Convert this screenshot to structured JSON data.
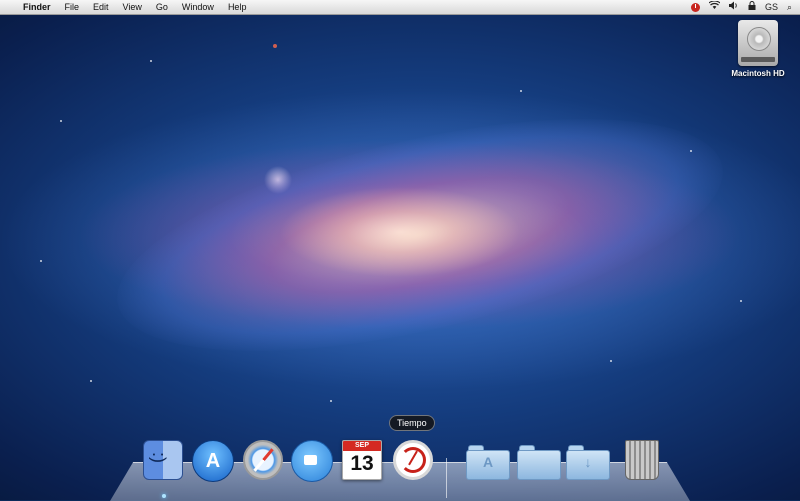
{
  "menubar": {
    "apple_glyph": "",
    "app_name": "Finder",
    "menus": [
      "File",
      "Edit",
      "View",
      "Go",
      "Window",
      "Help"
    ],
    "status_icons": {
      "time_machine": "time-machine-icon",
      "wifi": "wifi-icon",
      "volume": "volume-icon",
      "lock": "lock-icon"
    },
    "user": "GS",
    "spotlight_glyph": "⌕"
  },
  "desktop": {
    "hd_label": "Macintosh HD"
  },
  "dock": {
    "tooltip": "Tiempo",
    "ical": {
      "month": "SEP",
      "day": "13"
    },
    "appstore_glyph": "A",
    "apps_folder_glyph": "A",
    "downloads_folder_glyph": "↓",
    "items": [
      "finder",
      "app-store",
      "safari",
      "facetime",
      "ical",
      "tiempo",
      "applications-folder",
      "documents-folder",
      "downloads-folder",
      "trash"
    ]
  }
}
